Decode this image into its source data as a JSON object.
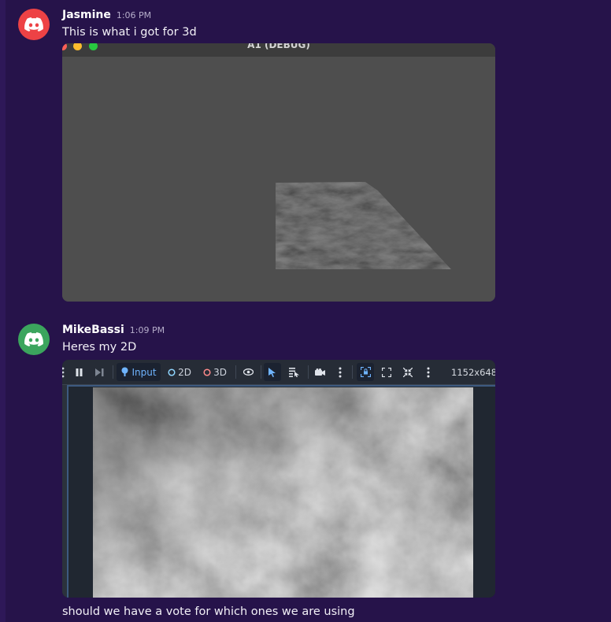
{
  "messages": [
    {
      "username": "Jasmine",
      "timestamp": "1:06 PM",
      "text": "This is what i got for 3d",
      "avatar_color": "#ed4245",
      "avatar_icon": "discord-logo-icon",
      "attachment": {
        "window_title": "A1 (DEBUG)"
      }
    },
    {
      "username": "MikeBassi",
      "timestamp": "1:09 PM",
      "text": "Heres my 2D",
      "avatar_color": "#3ba55d",
      "avatar_icon": "discord-logo-icon",
      "attachment": {
        "toolbar": {
          "input_label": "Input",
          "mode_2d_label": "2D",
          "mode_3d_label": "3D",
          "resolution": "1152x648"
        }
      }
    },
    {
      "text": "should we have a vote for which ones we are using"
    }
  ],
  "colors": {
    "background": "#26134a",
    "timestamp": "#b6aecb",
    "godot_accent": "#6fb4ff"
  }
}
